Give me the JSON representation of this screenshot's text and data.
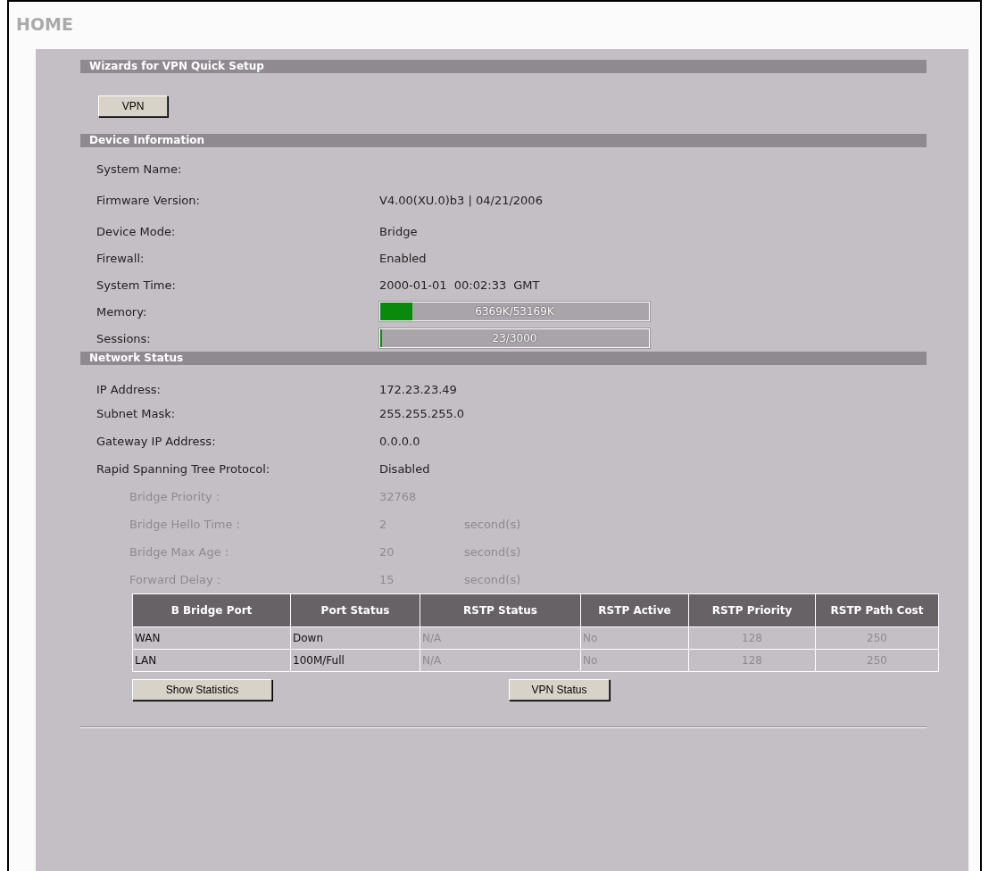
{
  "page_title": "HOME",
  "wizards": {
    "title": "Wizards for VPN Quick Setup",
    "buttons": [
      "VPN"
    ]
  },
  "device_information": {
    "title": "Device Information",
    "rows": [
      {
        "kind": "text",
        "label": "System Name:"
      },
      {
        "kind": "text",
        "label": "Firmware Version:",
        "value": "V4.00(XU.0)b3 | 04/21/2006"
      },
      {
        "kind": "text",
        "label": "Device Mode:",
        "value": "Bridge"
      },
      {
        "kind": "text",
        "label": "Firewall:",
        "value": "Enabled"
      },
      {
        "kind": "time",
        "label": "System Time:",
        "value": "2000-01-01  00:02:33",
        "unit": "GMT"
      },
      {
        "kind": "meter",
        "label": "Memory:",
        "reading": "6369K/53169K",
        "level": 0.12
      },
      {
        "kind": "meter",
        "label": "Sessions:",
        "reading": "23/3000",
        "level": 0.008
      }
    ]
  },
  "network_status": {
    "title": "Network Status",
    "rows": [
      {
        "label": "IP Address:",
        "value": "172.23.23.49",
        "disabled": false
      },
      {
        "label": "Subnet Mask:",
        "value": "255.255.255.0",
        "disabled": false
      },
      {
        "label": "Gateway IP Address:",
        "value": "0.0.0.0",
        "disabled": false
      },
      {
        "label": "Rapid Spanning Tree Protocol:",
        "value": "Disabled",
        "disabled": false
      },
      {
        "label": "Bridge Priority :",
        "value": "32768",
        "disabled": true
      },
      {
        "label": "Bridge Hello Time :",
        "value": "2",
        "unit": "second(s)",
        "disabled": true
      },
      {
        "label": "Bridge Max Age :",
        "value": "20",
        "unit": "second(s)",
        "disabled": true
      },
      {
        "label": "Forward Delay :",
        "value": "15",
        "unit": "second(s)",
        "disabled": true
      }
    ],
    "table": {
      "columns": [
        "B Bridge Port",
        "Port Status",
        "RSTP Status",
        "RSTP Active",
        "RSTP Priority",
        "RSTP Path Cost"
      ],
      "rows": [
        [
          {
            "text": "WAN",
            "disabled": false
          },
          {
            "text": "Down",
            "disabled": false
          },
          {
            "text": "N/A",
            "disabled": true
          },
          {
            "text": "No",
            "disabled": true
          },
          {
            "text": "128",
            "disabled": true
          },
          {
            "text": "250",
            "disabled": true
          }
        ],
        [
          {
            "text": "LAN",
            "disabled": false
          },
          {
            "text": "100M/Full",
            "disabled": false
          },
          {
            "text": "N/A",
            "disabled": true
          },
          {
            "text": "No",
            "disabled": true
          },
          {
            "text": "128",
            "disabled": true
          },
          {
            "text": "250",
            "disabled": true
          }
        ]
      ]
    },
    "buttons": [
      "Show Statistics",
      "VPN Status"
    ]
  }
}
